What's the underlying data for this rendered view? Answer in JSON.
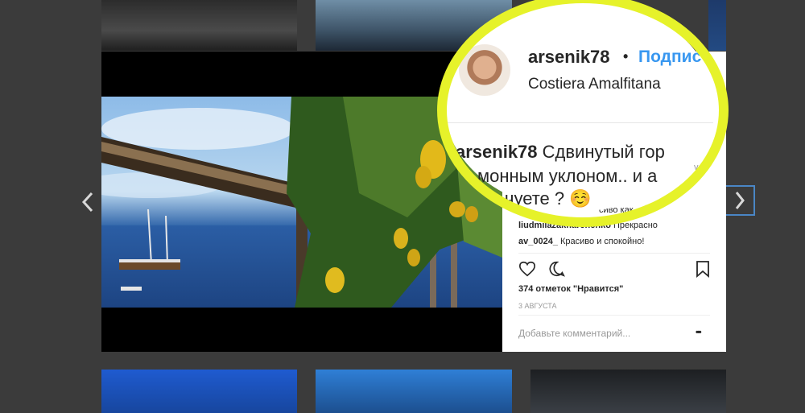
{
  "post": {
    "username": "arsenik78",
    "separator": "•",
    "follow_label": "Подпис",
    "location": "Costiera Amalfitana"
  },
  "caption_zoom": {
    "line1_user": "arsenik78",
    "line1_text": "Сдвинутый гор",
    "line2": "монным уклоном.. и а",
    "line3": "чуете ?",
    "emoji": "☺️"
  },
  "side_fragment": "vel",
  "comments": [
    {
      "user": "",
      "text": "сиво как..",
      "emoji": "👍🏽"
    },
    {
      "user": "liudmilazakharchenko",
      "text": "Прекрасно"
    },
    {
      "user": "av_0024_",
      "text": "Красиво и спокойно!"
    }
  ],
  "likes_text": "374 отметок \"Нравится\"",
  "date_text": "3 АВГУСТА",
  "comment_placeholder": "Добавьте комментарий...",
  "more_label": "•••",
  "icons": {
    "prev": "chevron-left-icon",
    "next": "chevron-right-icon",
    "like": "heart-icon",
    "comment": "speech-bubble-icon",
    "save": "bookmark-icon"
  },
  "colors": {
    "accent": "#3897f0",
    "highlight_ring": "#e6f22a",
    "overlay_bg": "#3b3b3b"
  }
}
